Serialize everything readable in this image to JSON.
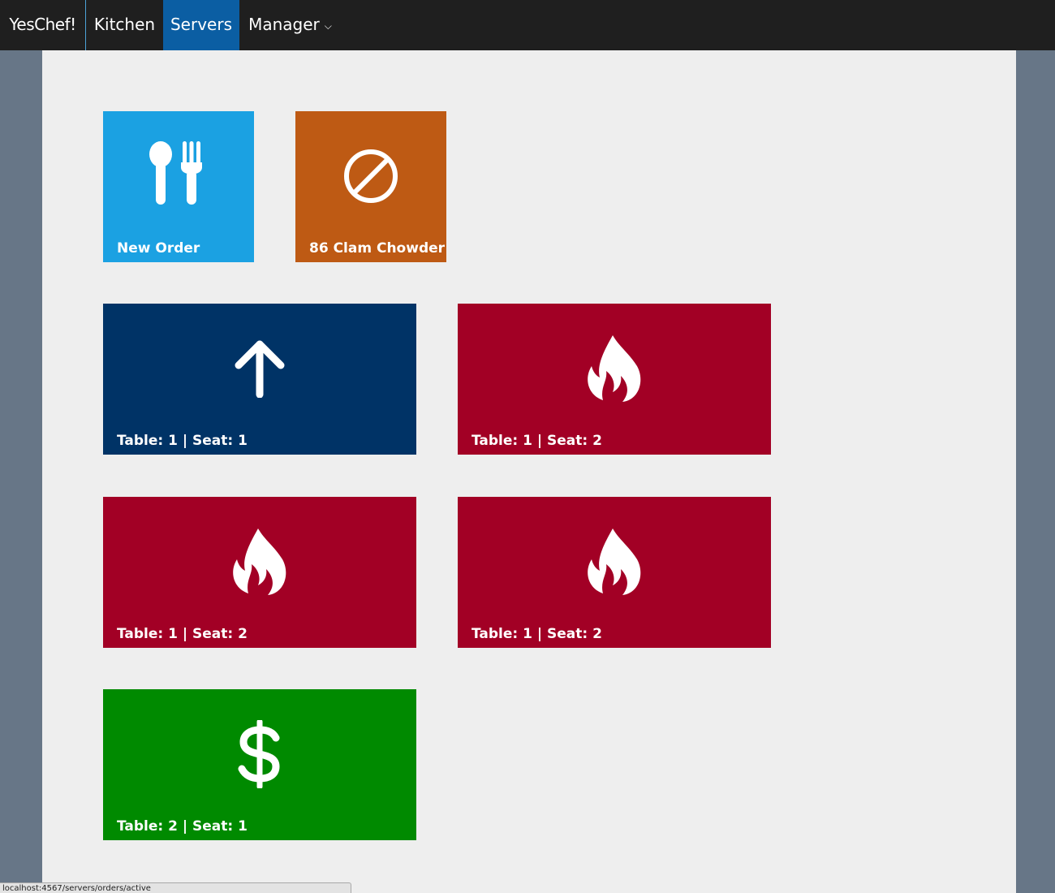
{
  "navbar": {
    "brand": "YesChef!",
    "items": [
      {
        "label": "Kitchen",
        "active": false
      },
      {
        "label": "Servers",
        "active": true
      },
      {
        "label": "Manager",
        "dropdown": true
      }
    ],
    "caret": "⌵"
  },
  "actions": [
    {
      "label": "New Order",
      "icon": "utensils-icon",
      "color": "#1ba1e2"
    },
    {
      "label": "86 Clam Chowder",
      "icon": "ban-icon",
      "color": "#be5a14"
    }
  ],
  "orders": [
    {
      "label": "Table: 1 | Seat: 1",
      "icon": "arrow-up-icon",
      "color": "#003366"
    },
    {
      "label": "Table: 1 | Seat: 2",
      "icon": "fire-icon",
      "color": "#a20025"
    },
    {
      "label": "Table: 1 | Seat: 2",
      "icon": "fire-icon",
      "color": "#a20025"
    },
    {
      "label": "Table: 1 | Seat: 2",
      "icon": "fire-icon",
      "color": "#a20025"
    },
    {
      "label": "Table: 2 | Seat: 1",
      "icon": "dollar-icon",
      "color": "#008a00"
    }
  ],
  "status_url": "localhost:4567/servers/orders/active"
}
